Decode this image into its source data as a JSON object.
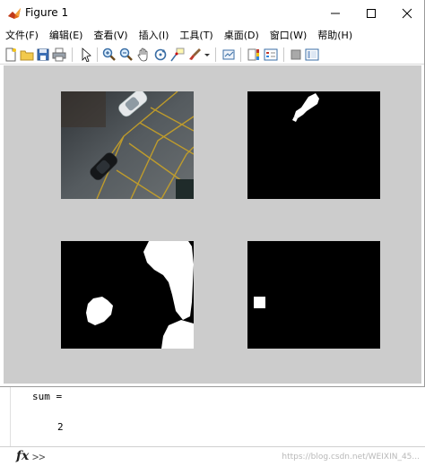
{
  "window": {
    "title": "Figure 1",
    "minimize_glyph": "—",
    "maximize_glyph": "☐",
    "close_glyph": "✕"
  },
  "menu": [
    {
      "label": "文件(F)"
    },
    {
      "label": "编辑(E)"
    },
    {
      "label": "查看(V)"
    },
    {
      "label": "插入(I)"
    },
    {
      "label": "工具(T)"
    },
    {
      "label": "桌面(D)"
    },
    {
      "label": "窗口(W)"
    },
    {
      "label": "帮助(H)"
    }
  ],
  "toolbar": {
    "icons": [
      "new-figure-icon",
      "open-file-icon",
      "save-icon",
      "print-icon",
      "pointer-icon",
      "zoom-in-icon",
      "zoom-out-icon",
      "pan-icon",
      "rotate-3d-icon",
      "data-cursor-icon",
      "brush-icon",
      "brush-dropdown-icon",
      "link-plot-icon",
      "colorbar-icon",
      "legend-icon",
      "hide-plot-tools-icon",
      "show-plot-tools-icon"
    ]
  },
  "console": {
    "output_label": "sum =",
    "output_value": "2",
    "fx_symbol": "fx",
    "prompt": ">>",
    "watermark": "https://blog.csdn.net/WEIXIN_45... "
  },
  "colors": {
    "canvas": "#cccccc",
    "axes_bg": "#000000",
    "mask_fg": "#ffffff",
    "parking_line": "#c9a227"
  }
}
